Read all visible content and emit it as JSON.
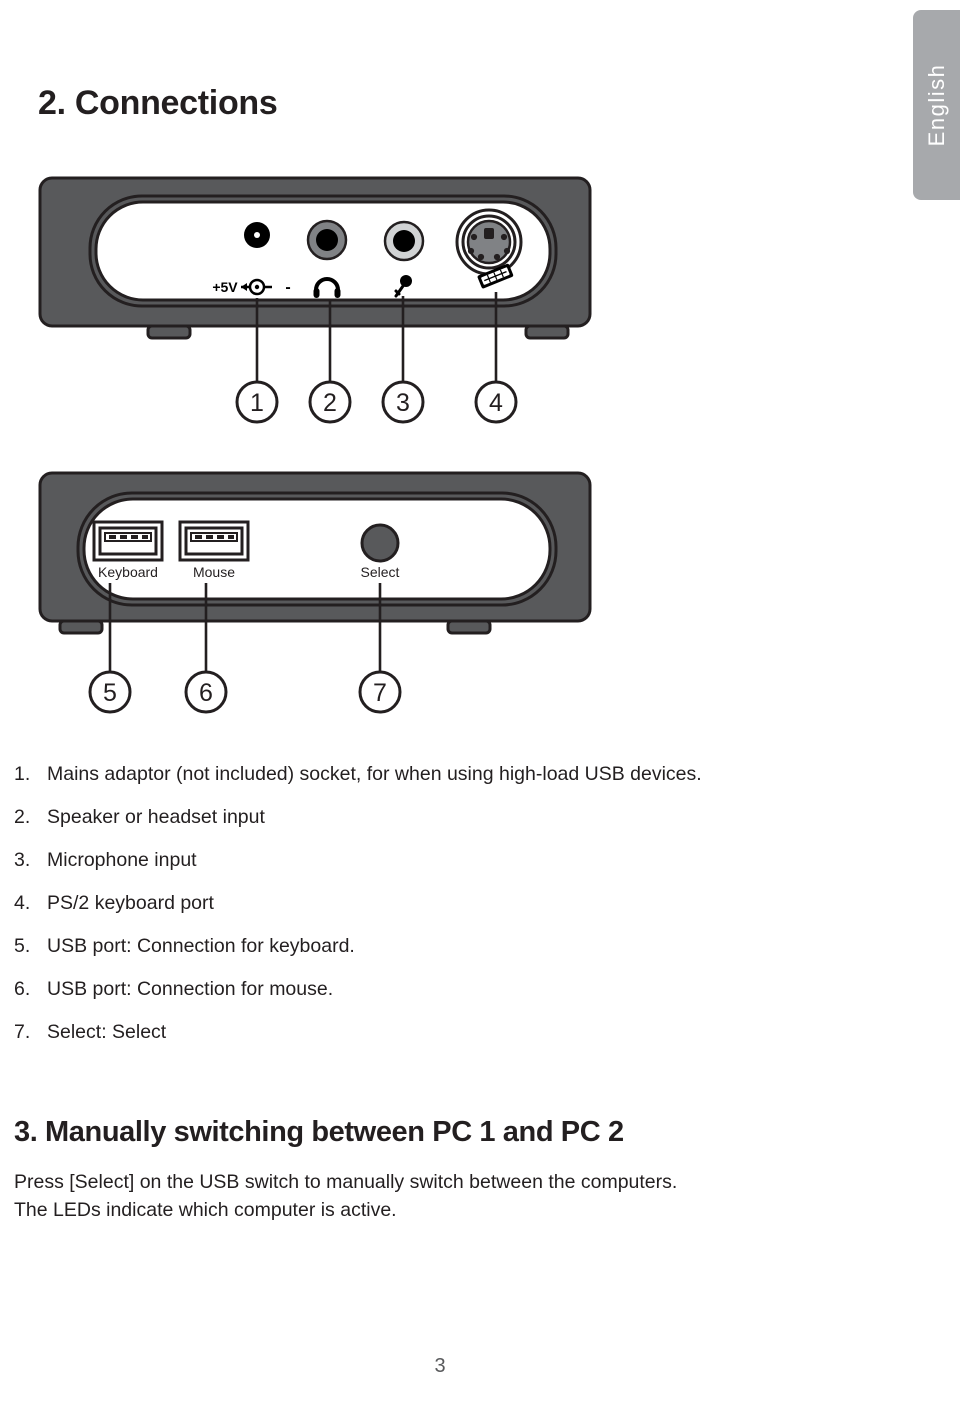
{
  "language_tab": {
    "label": "English"
  },
  "section_connections": {
    "heading": "2. Connections",
    "rear_panel": {
      "power_label_left": "+5V",
      "power_label_right": "-",
      "icons": [
        "power-jack-icon",
        "headphone-icon",
        "microphone-icon",
        "keyboard-icon"
      ],
      "callouts": [
        "1",
        "2",
        "3",
        "4"
      ]
    },
    "front_panel": {
      "port_labels": [
        "Keyboard",
        "Mouse"
      ],
      "button_label": "Select",
      "callouts": [
        "5",
        "6",
        "7"
      ]
    },
    "list": [
      {
        "n": "1.",
        "text": "Mains adaptor (not included) socket, for when using high-load USB devices."
      },
      {
        "n": "2.",
        "text": "Speaker or headset input"
      },
      {
        "n": "3.",
        "text": "Microphone input"
      },
      {
        "n": "4.",
        "text": "PS/2 keyboard port"
      },
      {
        "n": "5.",
        "text": "USB port: Connection for keyboard."
      },
      {
        "n": "6.",
        "text": "USB port: Connection for mouse."
      },
      {
        "n": "7.",
        "text": "Select: Select"
      }
    ]
  },
  "section_switching": {
    "heading": "3. Manually switching between PC 1 and PC 2",
    "line1": "Press [Select] on the USB switch to manually switch between the computers.",
    "line2": "The LEDs indicate which computer is active."
  },
  "footer": {
    "page_number": "3"
  },
  "colors": {
    "chassis": "#58595b",
    "chassis_stroke": "#231f20",
    "tab_gray": "#a7a9ac",
    "text": "#231f20",
    "panel_white": "#ffffff",
    "jack_ring_dark": "#808285",
    "jack_ring_light": "#d1d3d4",
    "button_gray": "#58595b"
  }
}
